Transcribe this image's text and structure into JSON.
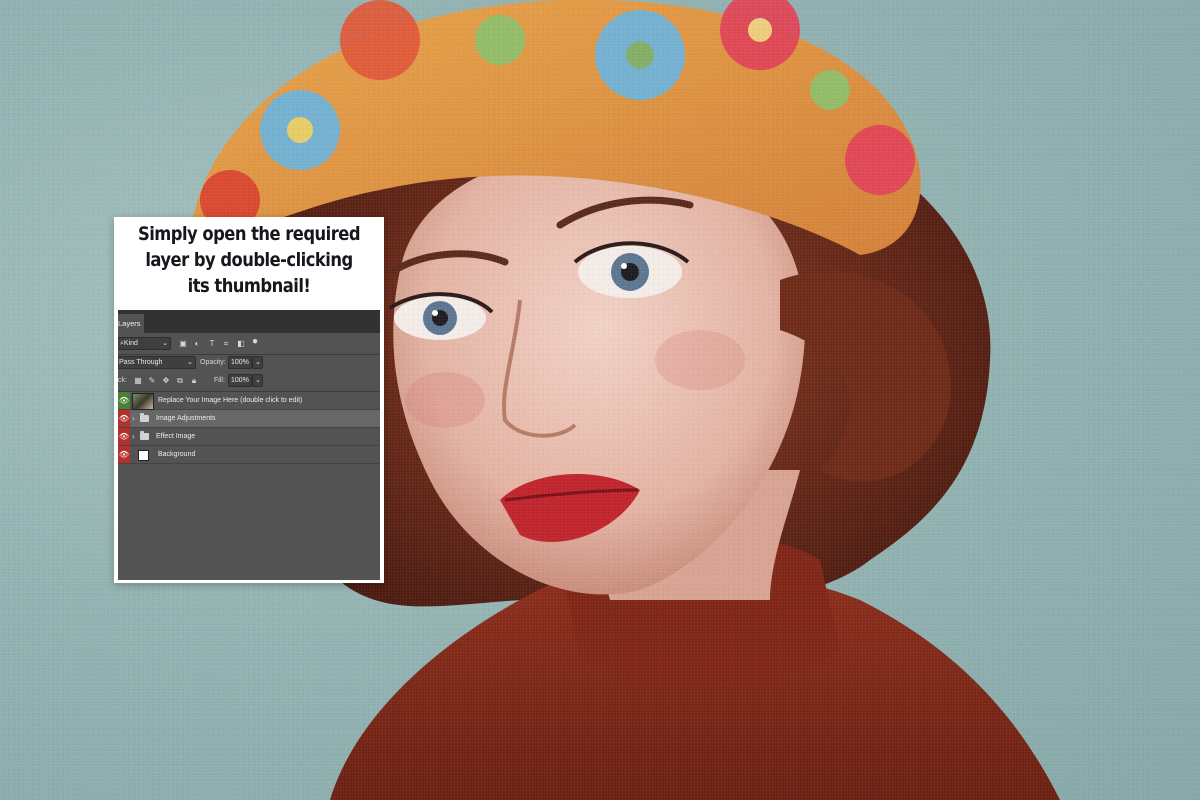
{
  "card": {
    "headline": [
      "Simply open the required",
      "layer by double-clicking",
      "its thumbnail!"
    ]
  },
  "layers_panel": {
    "tab": "Layers",
    "filter_kind": "Kind",
    "blend_mode": "Pass Through",
    "opacity_label": "Opacity:",
    "opacity_value": "100%",
    "lock_label": "ck:",
    "fill_label": "Fill:",
    "fill_value": "100%",
    "layers": [
      {
        "name": "Replace Your Image Here (double click to edit)",
        "eye_color": "#4a7f34",
        "thumb": "photo",
        "group": false,
        "selected": false
      },
      {
        "name": "Image Adjustments",
        "eye_color": "#b3302d",
        "thumb": "folder",
        "group": true,
        "selected": true
      },
      {
        "name": "Effect Image",
        "eye_color": "#b3302d",
        "thumb": "folder",
        "group": true,
        "selected": false
      },
      {
        "name": "Background",
        "eye_color": "#b3302d",
        "thumb": "white",
        "group": false,
        "selected": false
      }
    ]
  },
  "colors": {
    "backdrop": "#8fb1b1",
    "panel_bg": "#535353",
    "selected_row": "#676767"
  }
}
